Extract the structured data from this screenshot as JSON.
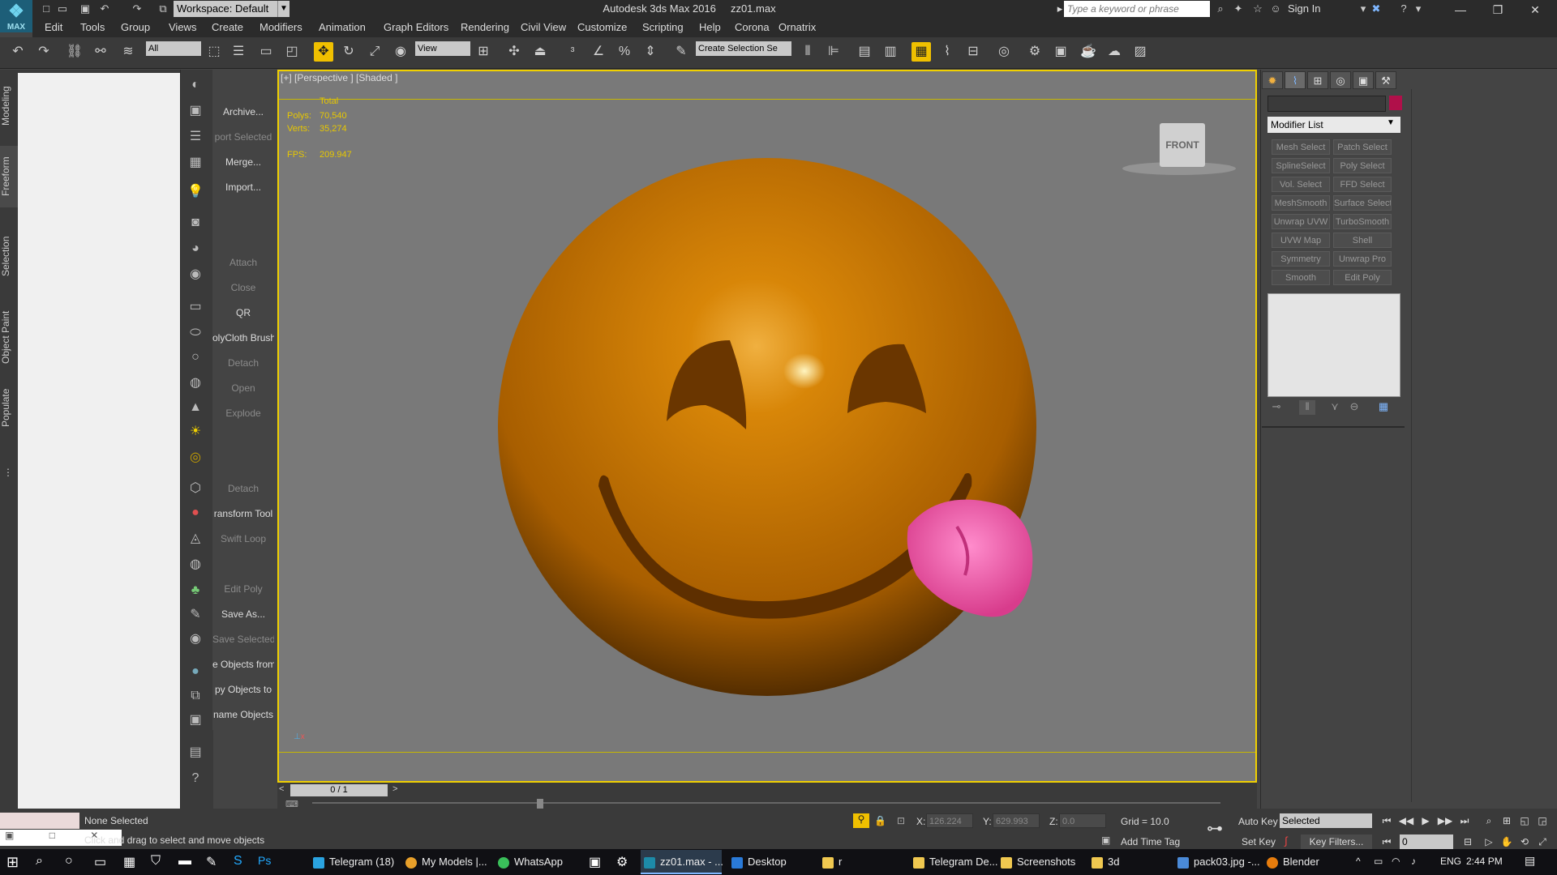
{
  "app": {
    "title": "Autodesk 3ds Max 2016",
    "file": "zz01.max",
    "logo_label": "MAX",
    "workspace": "Workspace: Default",
    "search_placeholder": "Type a keyword or phrase",
    "sign_in": "Sign In"
  },
  "menu": [
    "Edit",
    "Tools",
    "Group",
    "Views",
    "Create",
    "Modifiers",
    "Animation",
    "Graph Editors",
    "Rendering",
    "Civil View",
    "Customize",
    "Scripting",
    "Help",
    "Corona",
    "Ornatrix"
  ],
  "toolbar": {
    "filter": "All",
    "ref_coord": "View",
    "selection_set": "Create Selection Se"
  },
  "left_tabs": [
    "Modeling",
    "Freeform",
    "Selection",
    "Object Paint",
    "Populate"
  ],
  "script_panel": [
    {
      "label": "Archive...",
      "dim": false
    },
    {
      "label": "port Selected",
      "dim": true
    },
    {
      "label": "Merge...",
      "dim": false
    },
    {
      "label": "Import...",
      "dim": false
    },
    {
      "label": "",
      "dim": false
    },
    {
      "label": "",
      "dim": false
    },
    {
      "label": "Attach",
      "dim": true
    },
    {
      "label": "Close",
      "dim": true
    },
    {
      "label": "QR",
      "dim": false
    },
    {
      "label": "olyCloth Brushe",
      "dim": false
    },
    {
      "label": "Detach",
      "dim": true
    },
    {
      "label": "Open",
      "dim": true
    },
    {
      "label": "Explode",
      "dim": true
    },
    {
      "label": "",
      "dim": false
    },
    {
      "label": "",
      "dim": false
    },
    {
      "label": "Detach",
      "dim": true
    },
    {
      "label": "ransform Tool",
      "dim": false
    },
    {
      "label": "Swift Loop",
      "dim": true
    },
    {
      "label": "",
      "dim": false
    },
    {
      "label": "Edit Poly",
      "dim": true
    },
    {
      "label": "Save As...",
      "dim": false
    },
    {
      "label": "Save Selected",
      "dim": true
    },
    {
      "label": "e Objects from",
      "dim": false
    },
    {
      "label": "py Objects to",
      "dim": false
    },
    {
      "label": "name Objects",
      "dim": false
    }
  ],
  "viewport": {
    "label": "[+] [Perspective ] [Shaded ]",
    "stats_header": "Total",
    "polys_label": "Polys:",
    "polys_value": "70,540",
    "verts_label": "Verts:",
    "verts_value": "35,274",
    "fps_label": "FPS:",
    "fps_value": "209.947",
    "viewcube": "FRONT",
    "object_color": "#d27d08",
    "tongue_color": "#ee5ea6"
  },
  "timeline": {
    "frame": "0 / 1"
  },
  "command_panel": {
    "modifier_list": "Modifier List",
    "swatch_color": "#b0104a",
    "modifiers": [
      "Mesh Select",
      "Patch Select",
      "SplineSelect",
      "Poly Select",
      "Vol. Select",
      "FFD Select",
      "MeshSmooth",
      "Surface Select",
      "Unwrap UVW",
      "TurboSmooth",
      "UVW Map",
      "Shell",
      "Symmetry",
      "Unwrap Pro",
      "Smooth",
      "Edit Poly"
    ]
  },
  "status": {
    "selection": "None Selected",
    "prompt": "Click and drag to select and move objects",
    "x_label": "X:",
    "x_value": "126.224",
    "y_label": "Y:",
    "y_value": "629.993",
    "z_label": "Z:",
    "z_value": "0.0",
    "grid": "Grid = 10.0",
    "add_time_tag": "Add Time Tag",
    "auto_key": "Auto Key",
    "set_key": "Set Key",
    "key_mode": "Selected",
    "key_filters": "Key Filters...",
    "current_frame": "0"
  },
  "taskbar": {
    "items": [
      "Telegram (18)",
      "My Models |...",
      "WhatsApp",
      "",
      "",
      "zz01.max - ...",
      "Desktop",
      "r",
      "Telegram De...",
      "Screenshots",
      "3d",
      "pack03.jpg -...",
      "Blender"
    ],
    "lang": "ENG",
    "time": "2:44 PM"
  }
}
